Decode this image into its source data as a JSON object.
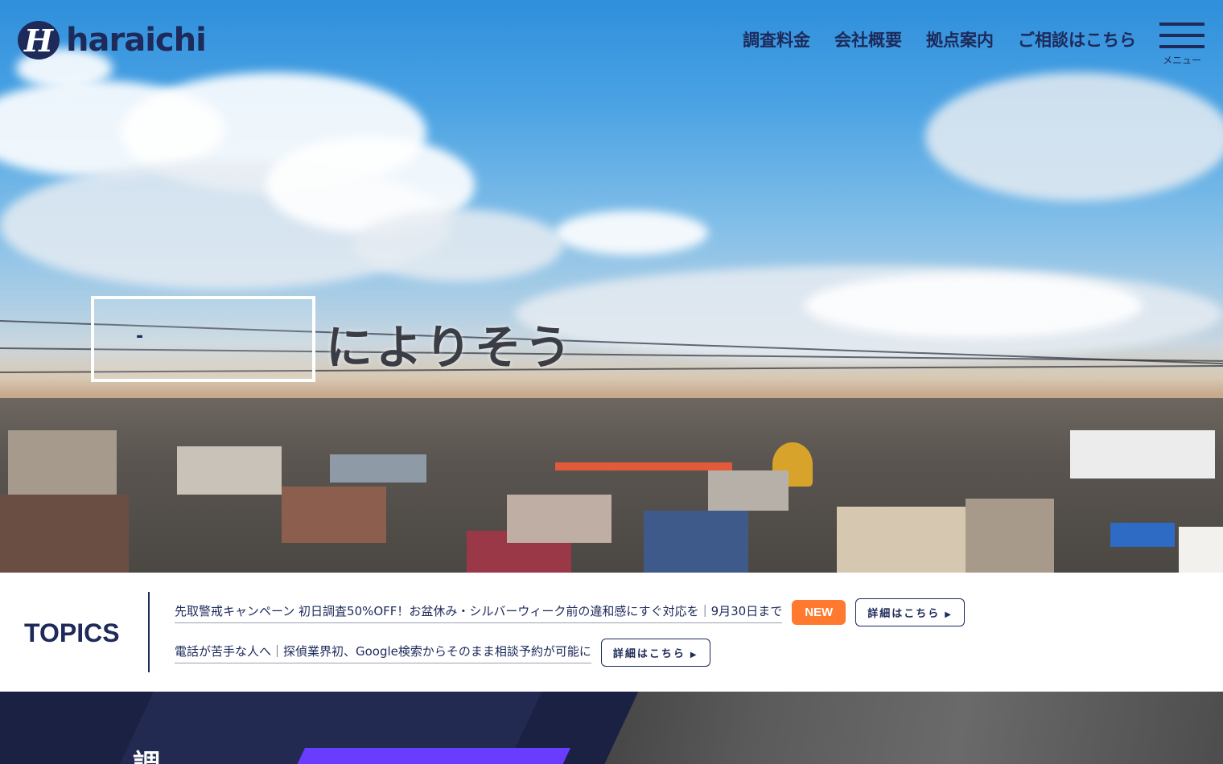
{
  "header": {
    "logo_text": "haraichi",
    "nav": [
      "調査料金",
      "会社概要",
      "拠点案内",
      "ご相談はこちら"
    ],
    "menu_label": "メニュー"
  },
  "hero": {
    "box_text": "-",
    "headline": "によりそう"
  },
  "topics": {
    "title": "TOPICS",
    "items": [
      {
        "text": "先取警戒キャンペーン 初日調査50%OFF！お盆休み・シルバーウィーク前の違和感にすぐ対応を｜9月30日まで",
        "badge": "NEW",
        "button": "詳細はこちら"
      },
      {
        "text": "電話が苦手な人へ｜探偵業界初、Google検索からそのまま相談予約が可能に",
        "button": "詳細はこちら"
      }
    ]
  },
  "bottom": {
    "heading_partial": "調"
  },
  "colors": {
    "navy": "#1d2a5a",
    "new_badge": "#ff7a2f",
    "accent_purple": "#6a3cff"
  }
}
